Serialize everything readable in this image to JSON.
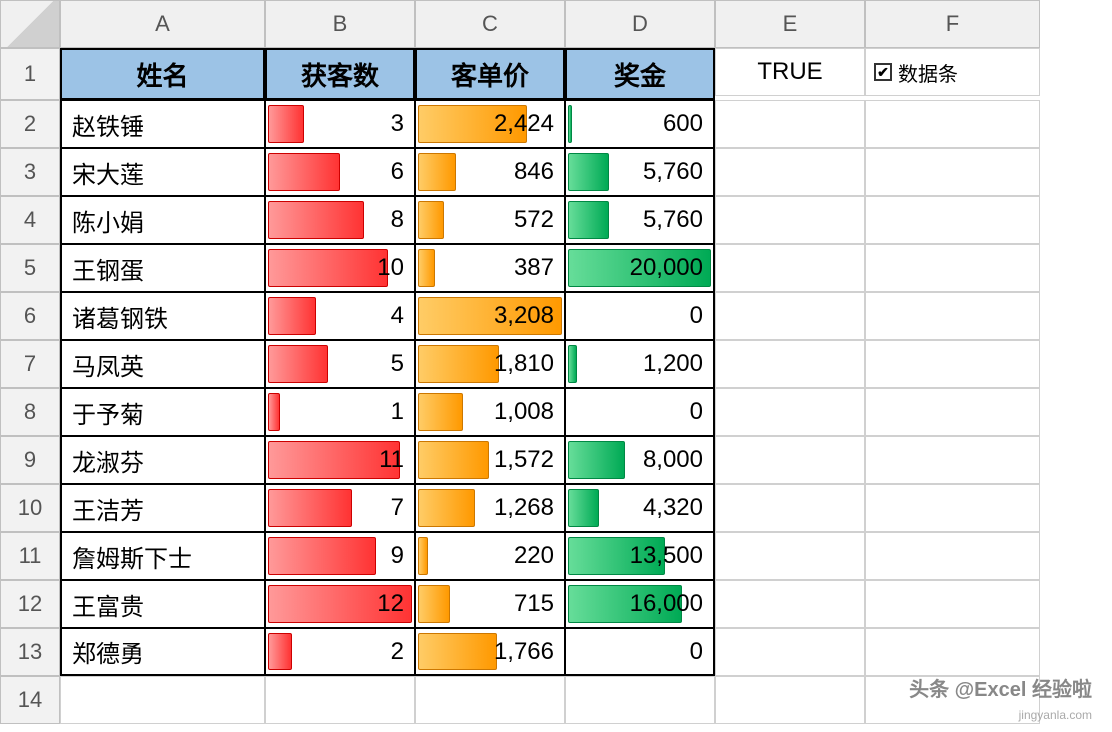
{
  "columns": [
    "A",
    "B",
    "C",
    "D",
    "E",
    "F"
  ],
  "row_numbers": [
    1,
    2,
    3,
    4,
    5,
    6,
    7,
    8,
    9,
    10,
    11,
    12,
    13,
    14
  ],
  "headers": {
    "name": "姓名",
    "customers": "获客数",
    "price": "客单价",
    "bonus": "奖金"
  },
  "cell_e1": "TRUE",
  "checkbox": {
    "label": "数据条",
    "checked": true
  },
  "rows": [
    {
      "name": "赵铁锤",
      "customers": 3,
      "price": "2,424",
      "bonus": "600",
      "price_val": 2424,
      "bonus_val": 600
    },
    {
      "name": "宋大莲",
      "customers": 6,
      "price": "846",
      "bonus": "5,760",
      "price_val": 846,
      "bonus_val": 5760
    },
    {
      "name": "陈小娟",
      "customers": 8,
      "price": "572",
      "bonus": "5,760",
      "price_val": 572,
      "bonus_val": 5760
    },
    {
      "name": "王钢蛋",
      "customers": 10,
      "price": "387",
      "bonus": "20,000",
      "price_val": 387,
      "bonus_val": 20000
    },
    {
      "name": "诸葛钢铁",
      "customers": 4,
      "price": "3,208",
      "bonus": "0",
      "price_val": 3208,
      "bonus_val": 0
    },
    {
      "name": "马凤英",
      "customers": 5,
      "price": "1,810",
      "bonus": "1,200",
      "price_val": 1810,
      "bonus_val": 1200
    },
    {
      "name": "于予菊",
      "customers": 1,
      "price": "1,008",
      "bonus": "0",
      "price_val": 1008,
      "bonus_val": 0
    },
    {
      "name": "龙淑芬",
      "customers": 11,
      "price": "1,572",
      "bonus": "8,000",
      "price_val": 1572,
      "bonus_val": 8000
    },
    {
      "name": "王洁芳",
      "customers": 7,
      "price": "1,268",
      "bonus": "4,320",
      "price_val": 1268,
      "bonus_val": 4320
    },
    {
      "name": "詹姆斯下士",
      "customers": 9,
      "price": "220",
      "bonus": "13,500",
      "price_val": 220,
      "bonus_val": 13500
    },
    {
      "name": "王富贵",
      "customers": 12,
      "price": "715",
      "bonus": "16,000",
      "price_val": 715,
      "bonus_val": 16000
    },
    {
      "name": "郑德勇",
      "customers": 2,
      "price": "1,766",
      "bonus": "0",
      "price_val": 1766,
      "bonus_val": 0
    }
  ],
  "max": {
    "customers": 12,
    "price": 3208,
    "bonus": 20000
  },
  "watermark": "头条 @Excel 经验啦",
  "watermark_sub": "jingyanla.com",
  "chart_data": {
    "type": "bar",
    "note": "In-cell data bars (conditional formatting) for columns B, C, D",
    "series": [
      {
        "name": "获客数",
        "color": "red",
        "categories": [
          "赵铁锤",
          "宋大莲",
          "陈小娟",
          "王钢蛋",
          "诸葛钢铁",
          "马凤英",
          "于予菊",
          "龙淑芬",
          "王洁芳",
          "詹姆斯下士",
          "王富贵",
          "郑德勇"
        ],
        "values": [
          3,
          6,
          8,
          10,
          4,
          5,
          1,
          11,
          7,
          9,
          12,
          2
        ]
      },
      {
        "name": "客单价",
        "color": "orange",
        "categories": [
          "赵铁锤",
          "宋大莲",
          "陈小娟",
          "王钢蛋",
          "诸葛钢铁",
          "马凤英",
          "于予菊",
          "龙淑芬",
          "王洁芳",
          "詹姆斯下士",
          "王富贵",
          "郑德勇"
        ],
        "values": [
          2424,
          846,
          572,
          387,
          3208,
          1810,
          1008,
          1572,
          1268,
          220,
          715,
          1766
        ]
      },
      {
        "name": "奖金",
        "color": "green",
        "categories": [
          "赵铁锤",
          "宋大莲",
          "陈小娟",
          "王钢蛋",
          "诸葛钢铁",
          "马凤英",
          "于予菊",
          "龙淑芬",
          "王洁芳",
          "詹姆斯下士",
          "王富贵",
          "郑德勇"
        ],
        "values": [
          600,
          5760,
          5760,
          20000,
          0,
          1200,
          0,
          8000,
          4320,
          13500,
          16000,
          0
        ]
      }
    ]
  }
}
